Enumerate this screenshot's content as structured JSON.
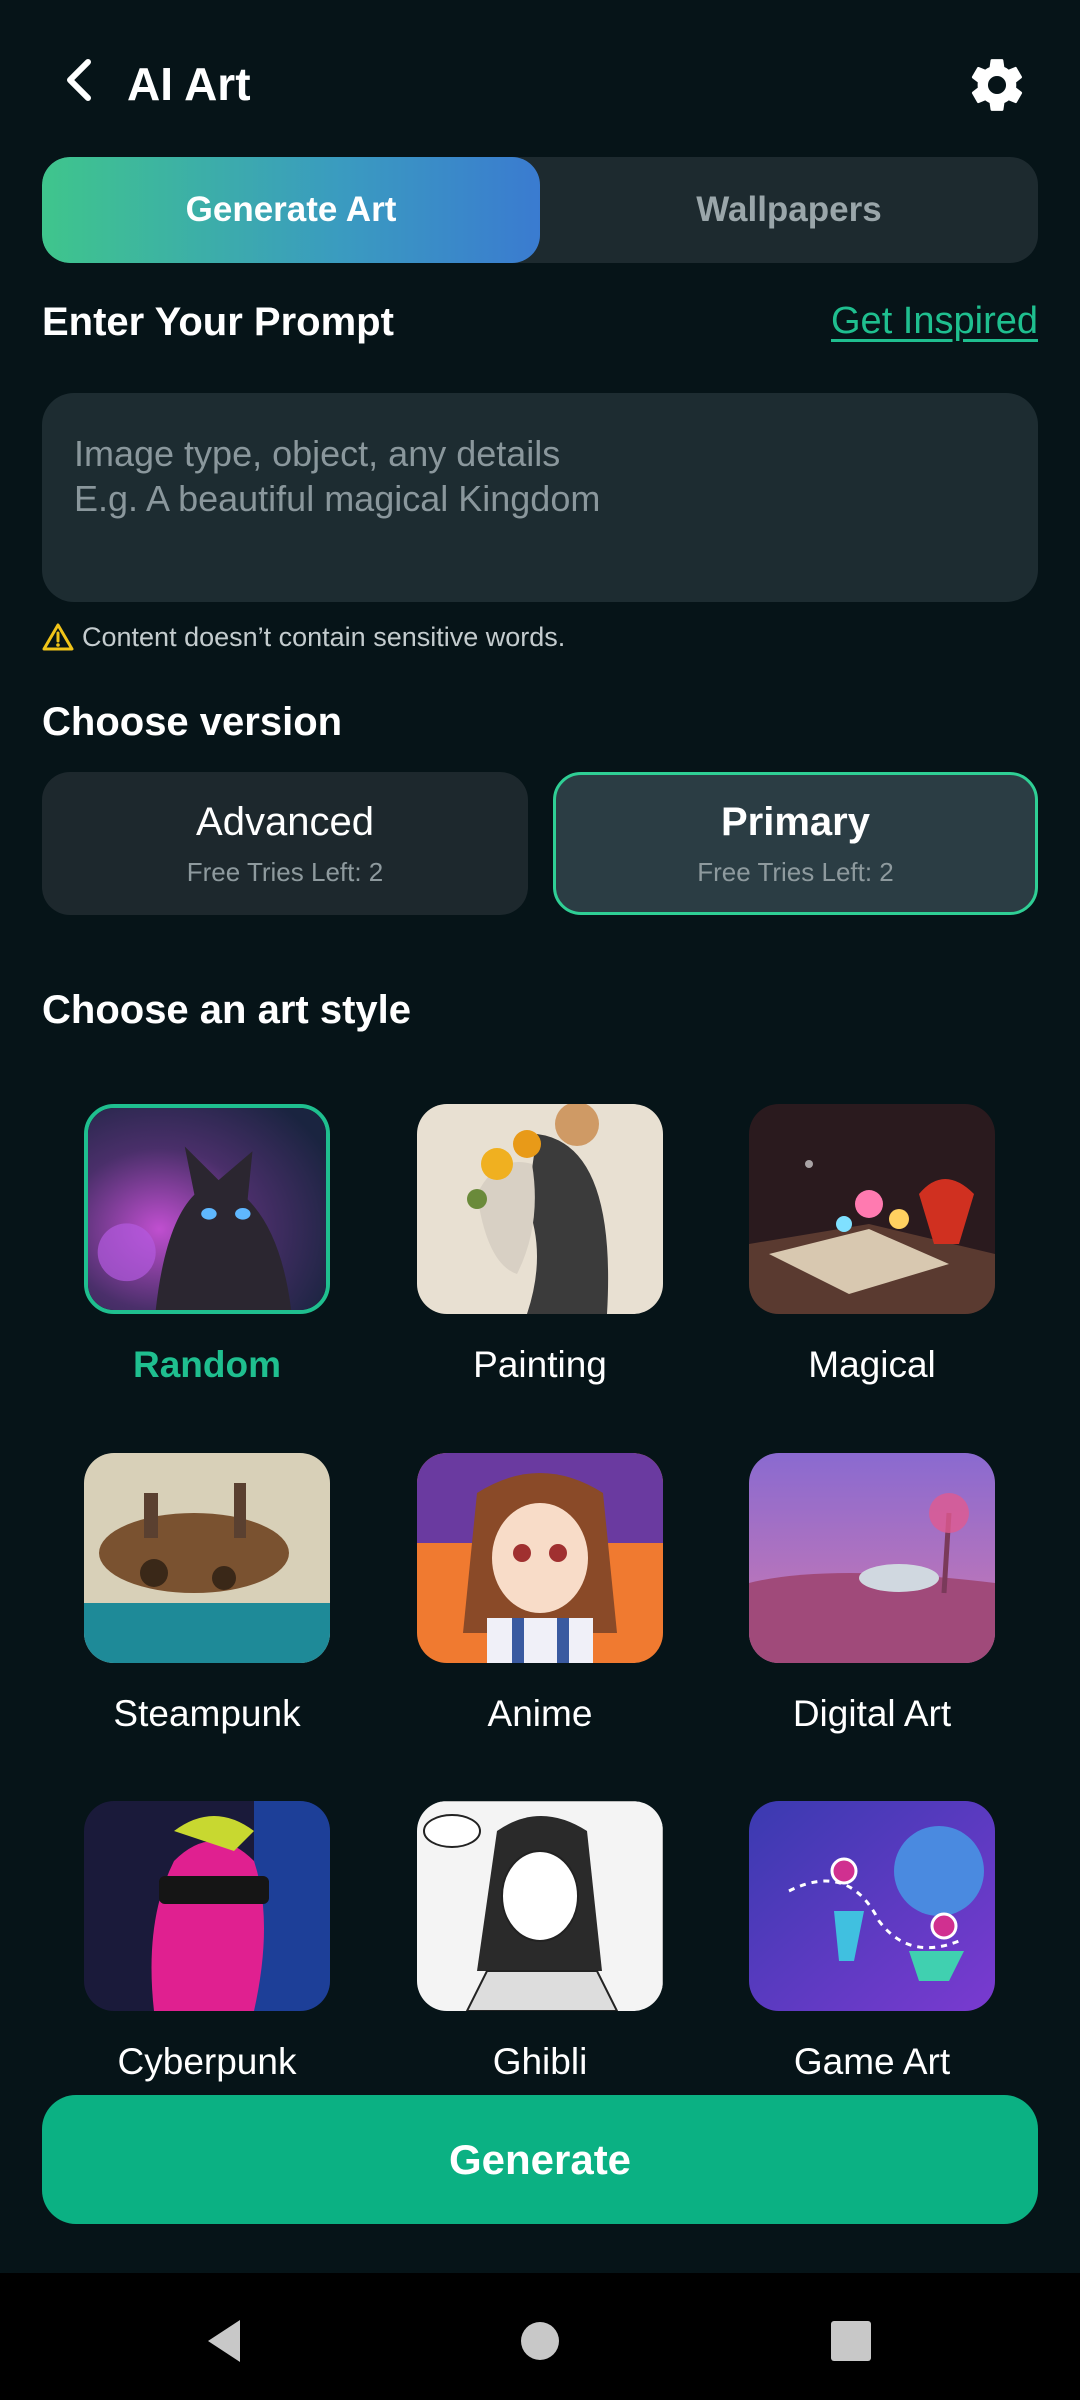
{
  "header": {
    "title": "AI Art",
    "back_icon": "back-arrow-icon",
    "settings_icon": "gear-icon"
  },
  "tabs": [
    {
      "label": "Generate Art",
      "active": true
    },
    {
      "label": "Wallpapers",
      "active": false
    }
  ],
  "prompt": {
    "title": "Enter Your Prompt",
    "get_inspired": "Get Inspired",
    "value": "",
    "placeholder": "Image type, object, any details\nE.g. A beautiful magical Kingdom",
    "warning": "Content doesn’t contain sensitive words."
  },
  "version": {
    "title": "Choose version",
    "options": [
      {
        "name": "Advanced",
        "tries": "Free Tries Left: 2",
        "selected": false
      },
      {
        "name": "Primary",
        "tries": "Free Tries Left: 2",
        "selected": true
      }
    ]
  },
  "art_style": {
    "title": "Choose an art style",
    "items": [
      {
        "label": "Random",
        "selected": true
      },
      {
        "label": "Painting",
        "selected": false
      },
      {
        "label": "Magical",
        "selected": false
      },
      {
        "label": "Steampunk",
        "selected": false
      },
      {
        "label": "Anime",
        "selected": false
      },
      {
        "label": "Digital Art",
        "selected": false
      },
      {
        "label": "Cyberpunk",
        "selected": false
      },
      {
        "label": "Ghibli",
        "selected": false
      },
      {
        "label": "Game Art",
        "selected": false
      }
    ]
  },
  "generate_label": "Generate",
  "colors": {
    "accent": "#1fbf8f",
    "background": "#061418",
    "button": "#0bb183"
  }
}
